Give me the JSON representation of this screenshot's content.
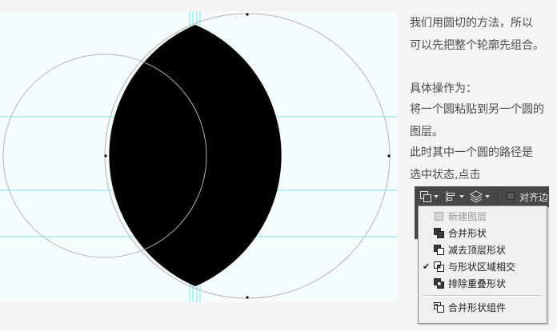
{
  "text": {
    "lines": [
      "我们用圆切的方法，所以",
      "可以先把整个轮廓先组合。",
      "",
      "具体操作为：",
      "将一个圆粘贴到另一个圆的",
      "图层。",
      "此时其中一个圆的路径是",
      "选中状态,点击"
    ]
  },
  "toolbar": {
    "path_ops_icon": "path-operations-icon",
    "path_align_icon": "path-alignment-icon",
    "path_arrange_icon": "path-arrangement-icon",
    "align_label": "对齐边"
  },
  "menu": {
    "items": [
      {
        "label": "新建图层",
        "icon": "new-layer-icon",
        "disabled": true,
        "checked": false
      },
      {
        "label": "合并形状",
        "icon": "combine-shapes-icon",
        "disabled": false,
        "checked": false
      },
      {
        "label": "减去顶层形状",
        "icon": "subtract-front-shape-icon",
        "disabled": false,
        "checked": false
      },
      {
        "label": "与形状区域相交",
        "icon": "intersect-shape-areas-icon",
        "disabled": false,
        "checked": true
      },
      {
        "label": "排除重叠形状",
        "icon": "exclude-overlapping-shapes-icon",
        "disabled": false,
        "checked": false
      }
    ],
    "footer_item": {
      "label": "合并形状组件",
      "icon": "merge-shape-components-icon"
    },
    "check_glyph": "✔"
  },
  "colors": {
    "canvas_bg": "#f5fcfd",
    "guide": "#7fe3ec",
    "circle_outline": "#b6b6b6",
    "shape_fill": "#000000",
    "text": "#4a4a4a",
    "toolbar_bg": "#474747",
    "menu_bg": "#f0f0f0"
  }
}
